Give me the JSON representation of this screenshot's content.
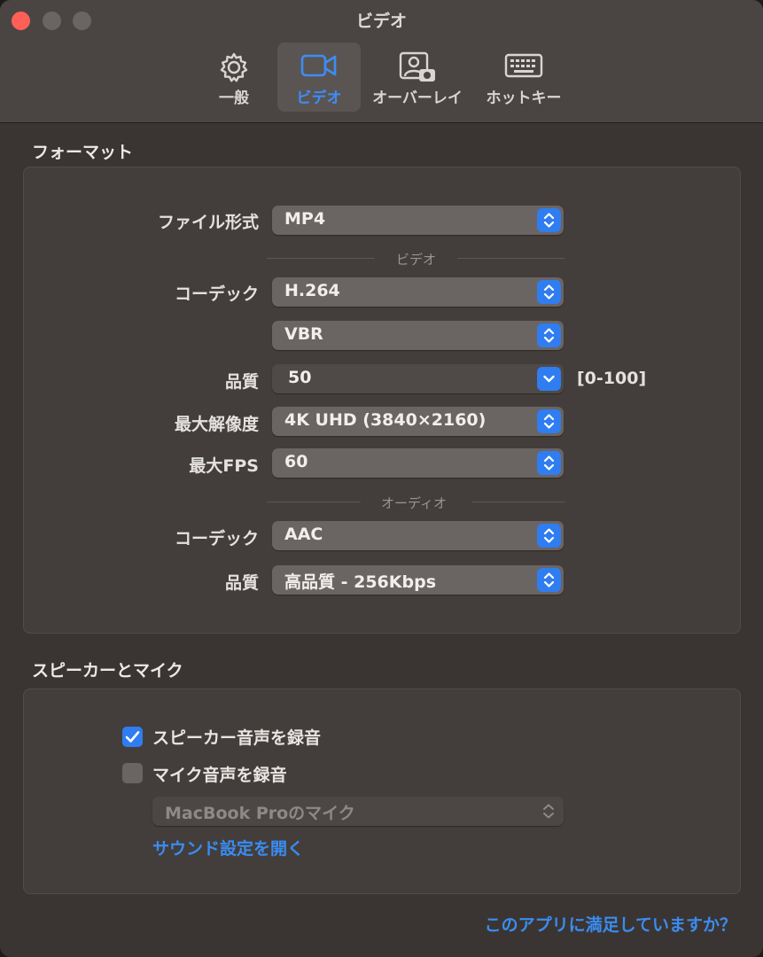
{
  "window": {
    "title": "ビデオ"
  },
  "tabs": [
    {
      "label": "一般",
      "icon": "gear-icon"
    },
    {
      "label": "ビデオ",
      "icon": "video-camera-icon",
      "active": true
    },
    {
      "label": "オーバーレイ",
      "icon": "overlay-camera-icon"
    },
    {
      "label": "ホットキー",
      "icon": "keyboard-icon"
    }
  ],
  "format": {
    "section_title": "フォーマット",
    "file_format_label": "ファイル形式",
    "file_format_value": "MP4",
    "video_divider": "ビデオ",
    "video_codec_label": "コーデック",
    "video_codec_value": "H.264",
    "bitrate_mode_value": "VBR",
    "quality_label": "品質",
    "quality_value": "50",
    "quality_range": "[0-100]",
    "max_resolution_label": "最大解像度",
    "max_resolution_value": "4K UHD (3840×2160)",
    "max_fps_label": "最大FPS",
    "max_fps_value": "60",
    "audio_divider": "オーディオ",
    "audio_codec_label": "コーデック",
    "audio_codec_value": "AAC",
    "audio_quality_label": "品質",
    "audio_quality_value": "高品質 - 256Kbps"
  },
  "speaker_mic": {
    "section_title": "スピーカーとマイク",
    "record_speaker_label": "スピーカー音声を録音",
    "record_speaker_checked": true,
    "record_mic_label": "マイク音声を録音",
    "record_mic_checked": false,
    "mic_device_value": "MacBook Proのマイク",
    "open_sound_settings_link": "サウンド設定を開く"
  },
  "footer": {
    "feedback_link": "このアプリに満足していますか？"
  },
  "colors": {
    "accent": "#2f7df0",
    "link": "#3a8cf2",
    "close": "#fe5f57"
  }
}
